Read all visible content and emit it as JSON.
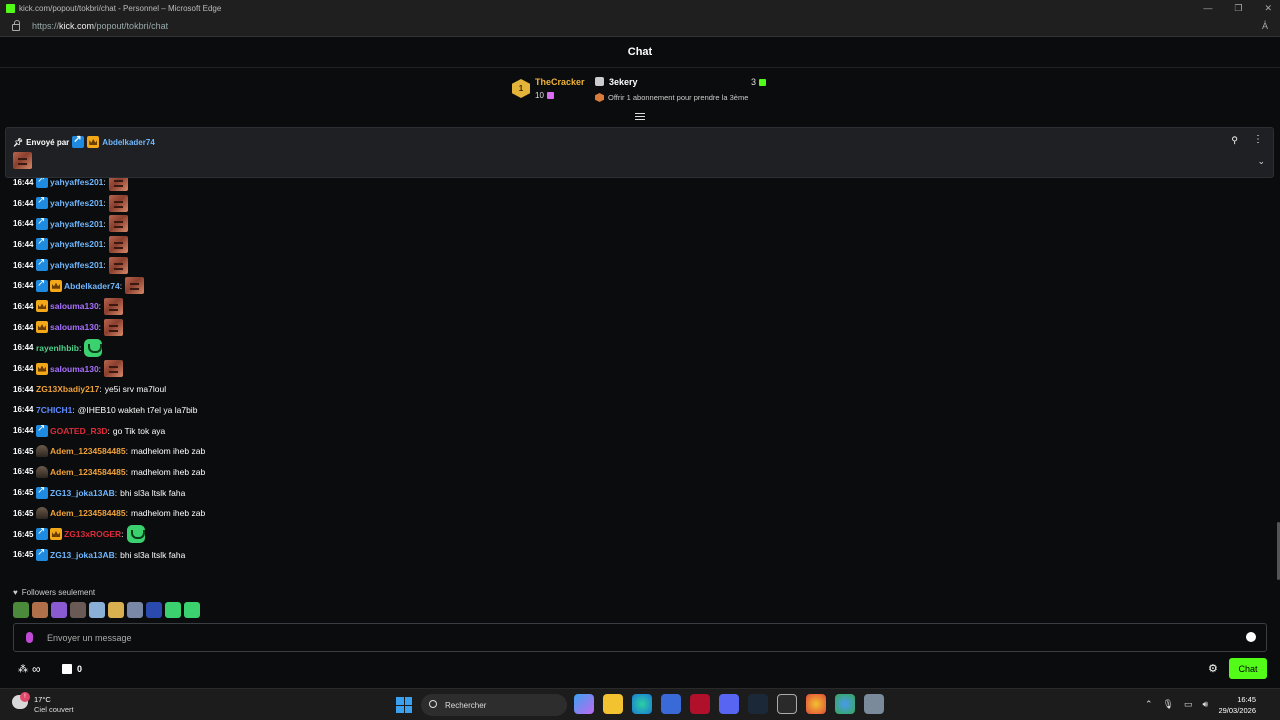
{
  "browser": {
    "title": "kick.com/popout/tokbri/chat - Personnel – Microsoft Edge",
    "url_prefix": "https://",
    "url_host": "kick.com",
    "url_path": "/popout/tokbri/chat",
    "window_controls": [
      "—",
      "❐",
      "✕"
    ]
  },
  "header": {
    "title": "Chat"
  },
  "leaderboard": {
    "rank": "1",
    "first_name": "TheCracker",
    "first_count": "10",
    "second_name": "3ekery",
    "second_count": "3",
    "offer_text": "Offrir 1 abonnement pour prendre la 3ème"
  },
  "pinned": {
    "label": "Envoyé par",
    "user": "Abdelkader74"
  },
  "colors": {
    "vip": "#6fb7ff",
    "crown_user": "#a970ff",
    "green": "#53fc18",
    "orange": "#f0a23a",
    "red": "#e02b3a",
    "blue": "#5e8bff",
    "teal": "#4fd08a"
  },
  "messages": [
    {
      "time": "16:44",
      "user": "yahyaffes201",
      "color": "#6fb7ff",
      "badges": [
        "vip"
      ],
      "text": "",
      "emote": "face"
    },
    {
      "time": "16:44",
      "user": "yahyaffes201",
      "color": "#6fb7ff",
      "badges": [
        "vip"
      ],
      "text": "",
      "emote": "face"
    },
    {
      "time": "16:44",
      "user": "yahyaffes201",
      "color": "#6fb7ff",
      "badges": [
        "vip"
      ],
      "text": "",
      "emote": "face"
    },
    {
      "time": "16:44",
      "user": "yahyaffes201",
      "color": "#6fb7ff",
      "badges": [
        "vip"
      ],
      "text": "",
      "emote": "face"
    },
    {
      "time": "16:44",
      "user": "yahyaffes201",
      "color": "#6fb7ff",
      "badges": [
        "vip"
      ],
      "text": "",
      "emote": "face"
    },
    {
      "time": "16:44",
      "user": "Abdelkader74",
      "color": "#6fb7ff",
      "badges": [
        "vip",
        "crown"
      ],
      "text": "",
      "emote": "face"
    },
    {
      "time": "16:44",
      "user": "salouma130",
      "color": "#a970ff",
      "badges": [
        "crown"
      ],
      "text": "",
      "emote": "face"
    },
    {
      "time": "16:44",
      "user": "salouma130",
      "color": "#a970ff",
      "badges": [
        "crown"
      ],
      "text": "",
      "emote": "face"
    },
    {
      "time": "16:44",
      "user": "rayenlhbib",
      "color": "#4fd08a",
      "badges": [],
      "text": "",
      "emote": "green"
    },
    {
      "time": "16:44",
      "user": "salouma130",
      "color": "#a970ff",
      "badges": [
        "crown"
      ],
      "text": "",
      "emote": "face"
    },
    {
      "time": "16:44",
      "user": "ZG13Xbadiy217",
      "color": "#f0a23a",
      "badges": [],
      "text": "ye5i srv ma7loul",
      "emote": ""
    },
    {
      "time": "16:44",
      "user": "7CHICH1",
      "color": "#5e8bff",
      "badges": [],
      "text": "@IHEB10 wakteh t7el ya la7bib",
      "emote": ""
    },
    {
      "time": "16:44",
      "user": "GOATED_R3D",
      "color": "#e02b3a",
      "badges": [
        "vip"
      ],
      "text": "go Tik tok aya",
      "emote": ""
    },
    {
      "time": "16:45",
      "user": "Adem_1234584485",
      "color": "#f0a23a",
      "badges": [
        "avatar"
      ],
      "text": "madhelom iheb zab",
      "emote": ""
    },
    {
      "time": "16:45",
      "user": "Adem_1234584485",
      "color": "#f0a23a",
      "badges": [
        "avatar"
      ],
      "text": "madhelom iheb zab",
      "emote": ""
    },
    {
      "time": "16:45",
      "user": "ZG13_joka13AB",
      "color": "#6fb7ff",
      "badges": [
        "vip"
      ],
      "text": "bhi sl3a ltslk faha",
      "emote": ""
    },
    {
      "time": "16:45",
      "user": "Adem_1234584485",
      "color": "#f0a23a",
      "badges": [
        "avatar"
      ],
      "text": "madhelom iheb zab",
      "emote": ""
    },
    {
      "time": "16:45",
      "user": "ZG13xROGER",
      "color": "#e02b3a",
      "badges": [
        "vip",
        "crown"
      ],
      "text": "",
      "emote": "green"
    },
    {
      "time": "16:45",
      "user": "ZG13_joka13AB",
      "color": "#6fb7ff",
      "badges": [
        "vip"
      ],
      "text": "bhi sl3a ltslk faha",
      "emote": ""
    }
  ],
  "followers_mode": "Followers seulement",
  "input": {
    "placeholder": "Envoyer un message"
  },
  "bottom": {
    "count": "0",
    "chat_button": "Chat"
  },
  "taskbar": {
    "temp": "17°C",
    "condition": "Ciel couvert",
    "search": "Rechercher",
    "time": "16:45",
    "date": "29/03/2026"
  }
}
